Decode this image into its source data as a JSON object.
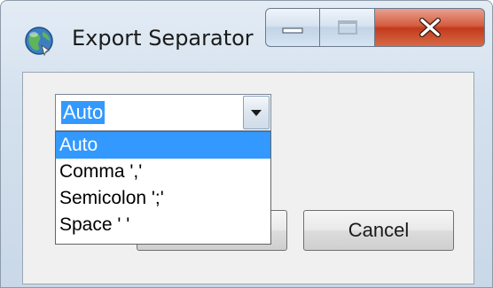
{
  "window": {
    "title": "Export Separator"
  },
  "caption_buttons": {
    "minimize_icon": "minimize-icon",
    "maximize_icon": "maximize-icon",
    "close_icon": "close-icon"
  },
  "separator_select": {
    "selected_value": "Auto",
    "options": [
      "Auto",
      "Comma ','",
      "Semicolon ';'",
      "Space ' '"
    ],
    "highlighted_option": "Auto"
  },
  "buttons": {
    "ok_label": "",
    "cancel_label": "Cancel"
  },
  "colors": {
    "selection": "#3399ff",
    "close_button": "#c8432a"
  }
}
